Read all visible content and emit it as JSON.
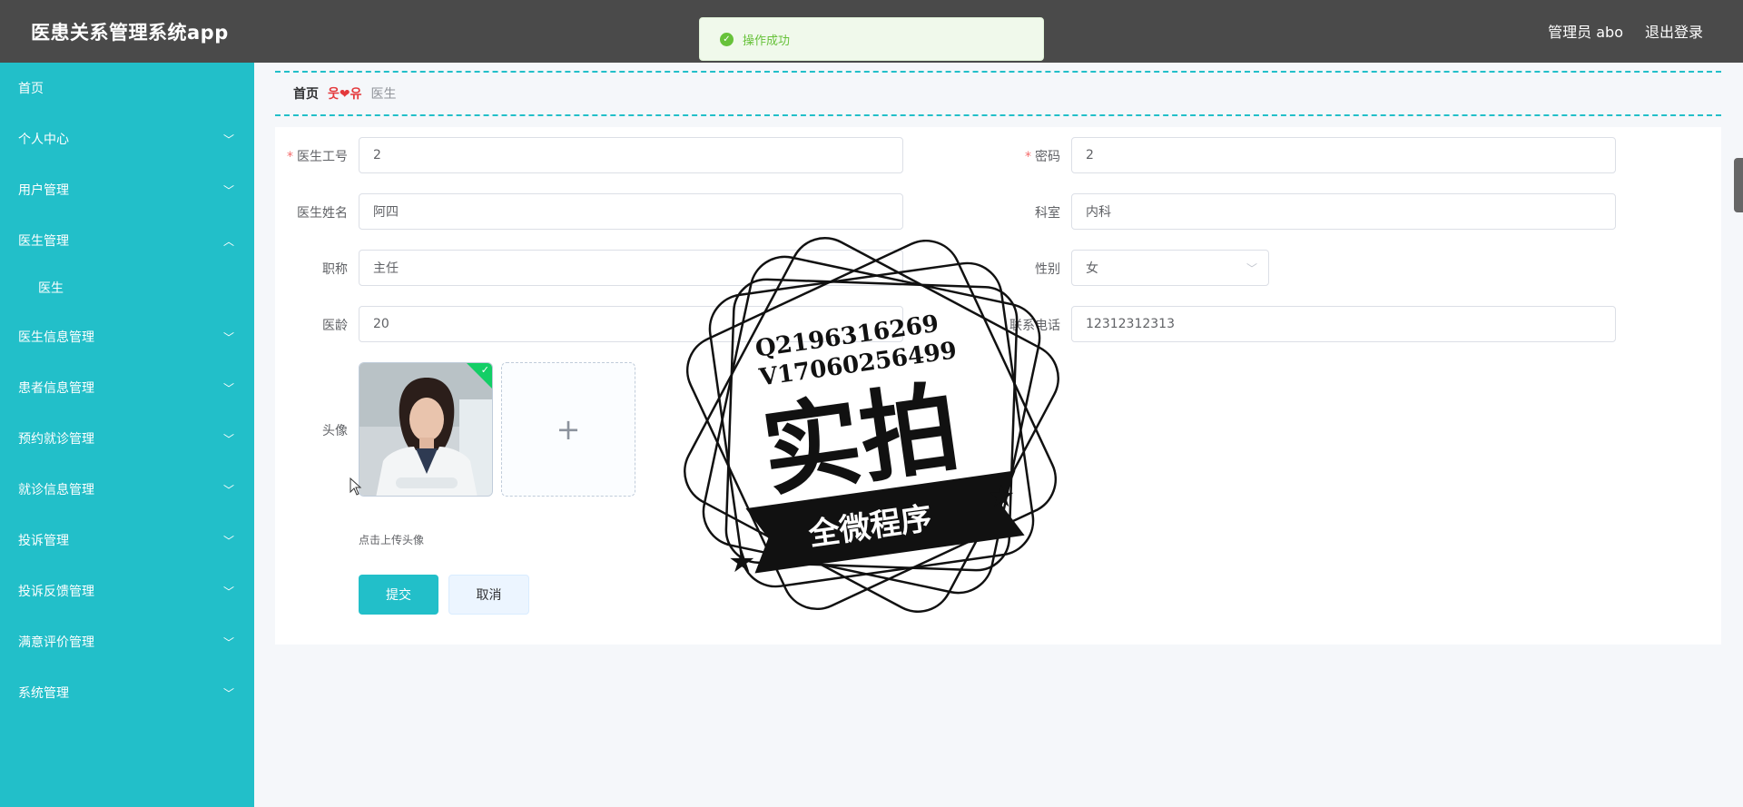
{
  "app": {
    "title": "医患关系管理系统app"
  },
  "header": {
    "user_label": "管理员 abo",
    "logout_label": "退出登录"
  },
  "toast": {
    "message": "操作成功",
    "icon": "success-check-icon",
    "color": "#67c23a"
  },
  "sidebar": {
    "color": "#22bfc9",
    "items": [
      {
        "label": "首页",
        "chevron": ""
      },
      {
        "label": "个人中心",
        "chevron": "﹀"
      },
      {
        "label": "用户管理",
        "chevron": "﹀"
      },
      {
        "label": "医生管理",
        "chevron": "︿"
      },
      {
        "label": "医生",
        "chevron": ""
      },
      {
        "label": "医生信息管理",
        "chevron": "﹀"
      },
      {
        "label": "患者信息管理",
        "chevron": "﹀"
      },
      {
        "label": "预约就诊管理",
        "chevron": "﹀"
      },
      {
        "label": "就诊信息管理",
        "chevron": "﹀"
      },
      {
        "label": "投诉管理",
        "chevron": "﹀"
      },
      {
        "label": "投诉反馈管理",
        "chevron": "﹀"
      },
      {
        "label": "满意评价管理",
        "chevron": "﹀"
      },
      {
        "label": "系统管理",
        "chevron": "﹀"
      }
    ]
  },
  "breadcrumb": {
    "home": "首页",
    "separator": "웃❤유",
    "current": "医生"
  },
  "form": {
    "doctor_id": {
      "label": "医生工号",
      "value": "2"
    },
    "password": {
      "label": "密码",
      "value": "2"
    },
    "doctor_name": {
      "label": "医生姓名",
      "value": "阿四"
    },
    "department": {
      "label": "科室",
      "value": "内科"
    },
    "title": {
      "label": "职称",
      "value": "主任"
    },
    "gender": {
      "label": "性别",
      "value": "女"
    },
    "years": {
      "label": "医龄",
      "value": "20"
    },
    "phone": {
      "label": "联系电话",
      "value": "12312312313"
    },
    "avatar": {
      "label": "头像",
      "tip": "点击上传头像",
      "add_glyph": "+"
    },
    "submit_label": "提交",
    "cancel_label": "取消"
  },
  "watermark": {
    "line1": "Q2196316269",
    "line2": "V17060256499",
    "big": "实拍",
    "banner": "全微程序"
  }
}
